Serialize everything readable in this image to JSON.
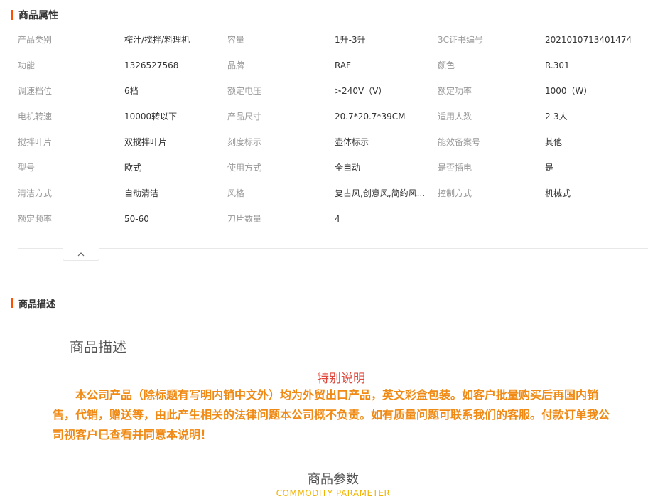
{
  "attributes_section": {
    "title": "商品属性",
    "rows": [
      [
        {
          "k": "产品类别",
          "v": "榨汁/搅拌/料理机"
        },
        {
          "k": "容量",
          "v": "1升-3升"
        },
        {
          "k": "3C证书编号",
          "v": "2021010713401474"
        }
      ],
      [
        {
          "k": "功能",
          "v": "1326527568"
        },
        {
          "k": "品牌",
          "v": "RAF"
        },
        {
          "k": "颜色",
          "v": "R.301"
        }
      ],
      [
        {
          "k": "调速档位",
          "v": "6档"
        },
        {
          "k": "额定电压",
          "v": ">240V（V）"
        },
        {
          "k": "额定功率",
          "v": "1000（W）"
        }
      ],
      [
        {
          "k": "电机转速",
          "v": "10000转以下"
        },
        {
          "k": "产品尺寸",
          "v": "20.7*20.7*39CM"
        },
        {
          "k": "适用人数",
          "v": "2-3人"
        }
      ],
      [
        {
          "k": "搅拌叶片",
          "v": "双搅拌叶片"
        },
        {
          "k": "刻度标示",
          "v": "壶体标示"
        },
        {
          "k": "能效备案号",
          "v": "其他"
        }
      ],
      [
        {
          "k": "型号",
          "v": "欧式"
        },
        {
          "k": "使用方式",
          "v": "全自动"
        },
        {
          "k": "是否插电",
          "v": "是"
        }
      ],
      [
        {
          "k": "清洁方式",
          "v": "自动清洁"
        },
        {
          "k": "风格",
          "v": "复古风,创意风,简约风..."
        },
        {
          "k": "控制方式",
          "v": "机械式"
        }
      ],
      [
        {
          "k": "额定频率",
          "v": "50-60"
        },
        {
          "k": "刀片数量",
          "v": "4"
        },
        {
          "k": "",
          "v": ""
        }
      ]
    ]
  },
  "collapse_button": {
    "icon": "chevron-up-icon"
  },
  "description_section": {
    "title": "商品描述",
    "heading": "商品描述",
    "special_title": "特别说明",
    "notice": "本公司产品（除标题有写明内销中文外）均为外贸出口产品，英文彩盒包装。如客户批量购买后再国内销售，代销，赠送等，由此产生相关的法律问题本公司概不负责。如有质量问题可联系我们的客服。付款订单我公司视客户已查看并同意本说明！",
    "param_heading": "商品参数",
    "param_sub": "COMMODITY  PARAMETER"
  },
  "colors": {
    "accent": "#ff5000",
    "notice": "#f08a14",
    "special": "#e0463a",
    "param_sub": "#f2b400"
  }
}
